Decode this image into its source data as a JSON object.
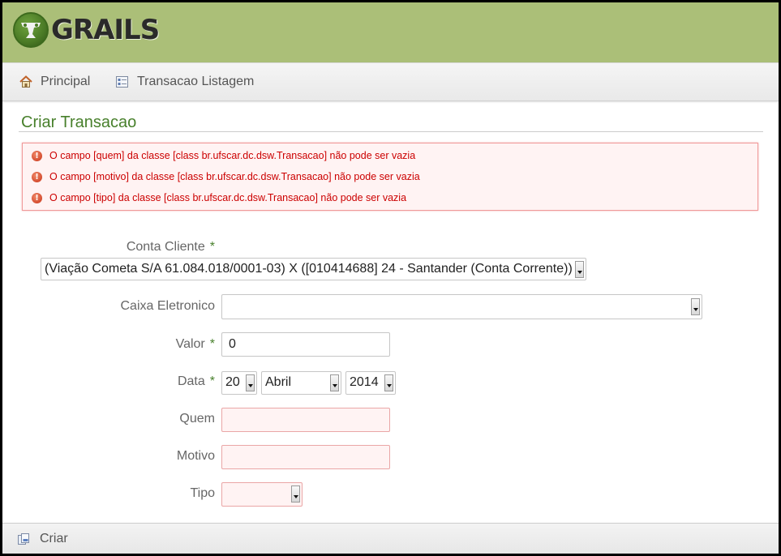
{
  "header": {
    "logo_text": "GRAILS"
  },
  "nav": {
    "home_label": "Principal",
    "list_label": "Transacao Listagem"
  },
  "page": {
    "title": "Criar Transacao"
  },
  "errors": [
    "O campo [quem] da classe [class br.ufscar.dc.dsw.Transacao] não pode ser vazia",
    "O campo [motivo] da classe [class br.ufscar.dc.dsw.Transacao] não pode ser vazia",
    "O campo [tipo] da classe [class br.ufscar.dc.dsw.Transacao] não pode ser vazia"
  ],
  "form": {
    "conta_cliente": {
      "label": "Conta Cliente",
      "required_mark": "*",
      "value": "(Viação Cometa S/A 61.084.018/0001-03) X ([010414688] 24 - Santander (Conta Corrente))"
    },
    "caixa_eletronico": {
      "label": "Caixa Eletronico",
      "value": ""
    },
    "valor": {
      "label": "Valor",
      "required_mark": "*",
      "value": "0"
    },
    "data": {
      "label": "Data",
      "required_mark": "*",
      "day": "20",
      "month": "Abril",
      "year": "2014"
    },
    "quem": {
      "label": "Quem",
      "value": ""
    },
    "motivo": {
      "label": "Motivo",
      "value": ""
    },
    "tipo": {
      "label": "Tipo",
      "value": ""
    }
  },
  "footer": {
    "create_label": "Criar"
  },
  "colors": {
    "header_bg": "#abbf78",
    "title_green": "#48802c",
    "error_red": "#cc0000",
    "error_bg": "#fff3f3"
  }
}
